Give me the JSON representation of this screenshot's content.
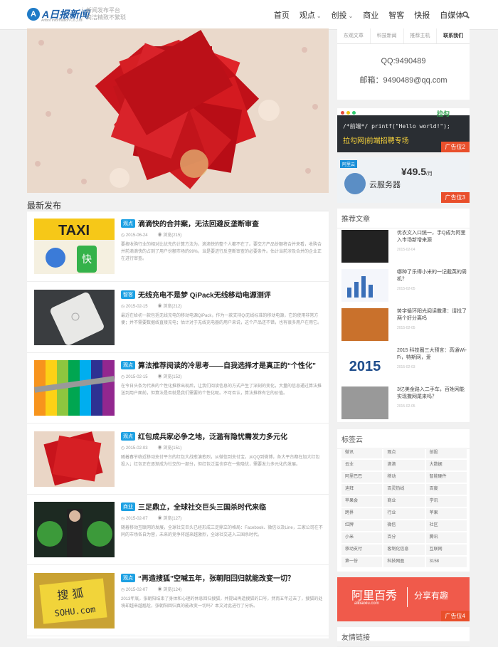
{
  "header": {
    "logo_text": "A日报新闻",
    "logo_sub": "Artbot Information Co.,Ltd",
    "tagline_1": "新闻发布平台",
    "tagline_2": "简洁精致不繁琐",
    "nav": [
      {
        "label": "首页",
        "has_caret": false
      },
      {
        "label": "观点",
        "has_caret": true
      },
      {
        "label": "创投",
        "has_caret": true
      },
      {
        "label": "商业",
        "has_caret": false
      },
      {
        "label": "智客",
        "has_caret": false
      },
      {
        "label": "快报",
        "has_caret": false
      },
      {
        "label": "自媒体",
        "has_caret": true
      }
    ]
  },
  "main": {
    "latest_title": "最新发布",
    "articles": [
      {
        "category": "观点",
        "title": "滴滴快的合并案，无法回避反垄断审查",
        "date": "2015-06-24",
        "views": "浏览(215)",
        "desc": "要按收购行业的相对比优先的计算方法为，滴滴快的整个人都不在了。要交方产品份额将合并来看，收购合并前滴滴快的占到了用户份额市场的99%，当是要进行反垄断审查的必要条件。估计当前涉及合并的企业正在进行审查。"
      },
      {
        "category": "智客",
        "title": "无线充电不是梦 QiPack无线移动电源测评",
        "date": "2015-02-15",
        "views": "浏览(212)",
        "desc": "最近在给初一款包括无线充电的移动电源QiPack，作为一款支持Qi无线标准的移动电源，它的使用非常方便；并不需要数据线直接充电；估计对于无线充电器的用户来说，这个产品还不错，也有很多用户在用它。"
      },
      {
        "category": "观点",
        "title": "算法推荐阅读的冷思考——自我选择才是真正的“个性化”",
        "date": "2015-02-15",
        "views": "浏览(152)",
        "desc": "在今日头条为代表的个性化推荐出现后，让我们阅读信息的方式产生了深刻的变化，大量的信息通过算法推送到用户面前，但算法是否就是我们需要的个性化呢。不可否认，算法推荐有它的价值。"
      },
      {
        "category": "观点",
        "title": "红包成兵家必争之地，泛滥有隐忧需发力多元化",
        "date": "2015-02-03",
        "views": "浏览(151)",
        "desc": "随着春节临近移动支付平台的红包大战愈演愈烈，从微信到支付宝，从QQ到微博，各大平台都在加大红包投入；红包正在逐渐成为社交的一部分，但红包泛滥也存在一些隐忧，需要发力多元化的发展。"
      },
      {
        "category": "商业",
        "title": "三足鼎立，全球社交巨头三国杀时代来临",
        "date": "2015-02-07",
        "views": "浏览(127)",
        "desc": "随着移动互联网的发展，全球社交巨头已经形成三足鼎立的格局：Facebook、微信以及Line，三家公司在不同的市场各自为营，未来的竞争将越来越激烈，全球社交进入三国杀时代。"
      },
      {
        "category": "观点",
        "title": "“再造搜狐”空喊五年，张朝阳回归就能改变一切？",
        "date": "2015-02-07",
        "views": "浏览(124)",
        "desc": "2013年底，张朝阳结束了身体和心理的休息回归搜狐，并提出再造搜狐的口号，然而五年过去了，搜狐的处境却越来越尴尬，张朝阳回归真的能改变一切吗？本文对此进行了分析。"
      }
    ]
  },
  "sidebar": {
    "tabs": [
      "东观文章",
      "科技新闻",
      "推荐主机",
      "联系我们"
    ],
    "qq": "QQ:9490489",
    "email": "邮箱：9490489@qq.com",
    "ad1": {
      "code": "/*前端*/ printf(\"Hello world!\");",
      "brand": "拉勾网|前端招聘专场",
      "badge": "广告位2"
    },
    "ad2": {
      "price": "¥49.5",
      "unit": "/月",
      "product": "云服务器",
      "brand": "阿里云",
      "badge": "广告位3"
    },
    "recommend_title": "推荐文章",
    "recommend": [
      {
        "title": "优衣文入口统一，手Q成为阿里入市场新增来源",
        "date": "2015-02-04"
      },
      {
        "title": "哪种了乐得小米的一记截英的周机？",
        "date": "2015-02-05"
      },
      {
        "title": "势字循环阳光阅读撒肃：请找了两个好分离吗",
        "date": "2015-02-05"
      },
      {
        "title": "2015 科技圈三大预言：高通Wi-Fi，特斯网，爱",
        "date": "2015-02-03"
      },
      {
        "title": "3亿美金路入二手车，百姓网能实现撒网尾来吗？",
        "date": "2015-02-05"
      }
    ],
    "tags_title": "标签云",
    "tags": [
      [
        "微讯",
        "观点",
        "创投"
      ],
      [
        "云业",
        "滴滴",
        "大数据"
      ],
      [
        "阿里巴巴",
        "移动",
        "智能硬件"
      ],
      [
        "迪拜",
        "百灵热线",
        "百度"
      ],
      [
        "苹果会",
        "商业",
        "学讯"
      ],
      [
        "跨界",
        "行业",
        "苹果"
      ],
      [
        "红牌",
        "微信",
        "社区"
      ],
      [
        "小米",
        "百分",
        "腾讯"
      ],
      [
        "移动支付",
        "客制化信息",
        "互联网"
      ],
      [
        "第一份",
        "科技网盈",
        "3158"
      ]
    ],
    "ad3": {
      "brand": "阿里百秀",
      "sub": "alibaixiu.com",
      "slogan": "分享有趣",
      "badge": "广告位4"
    },
    "bottom_title": "友情链接"
  },
  "colors": {
    "accent": "#1ea1e3",
    "badge": "#e94f2b",
    "ad_red": "#f05a4b"
  }
}
